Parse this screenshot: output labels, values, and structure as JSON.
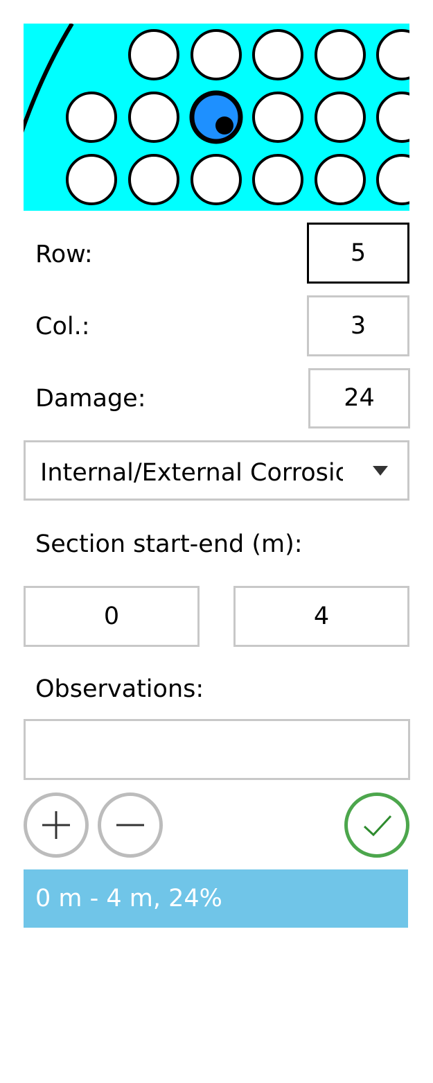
{
  "tube_map": {
    "background_color": "#00ffff",
    "selected_fill_color": "#1e90ff",
    "tube_fill_color": "#ffffff"
  },
  "row": {
    "label": "Row:",
    "value": "5"
  },
  "col": {
    "label": "Col.:",
    "value": "3"
  },
  "damage": {
    "label": "Damage:",
    "value": "24"
  },
  "damage_type": {
    "selected": "Internal/External Corrosion",
    "icon": "chevron-down-icon"
  },
  "section": {
    "label": "Section start-end (m):",
    "start": "0",
    "end": "4"
  },
  "observations": {
    "label": "Observations:",
    "value": ""
  },
  "actions": {
    "add_icon": "plus-icon",
    "remove_icon": "minus-icon",
    "confirm_icon": "checkmark-icon",
    "confirm_color": "#4ca64c"
  },
  "entries": [
    {
      "text": "0 m - 4 m, 24%",
      "color": "#70c5e8"
    }
  ]
}
